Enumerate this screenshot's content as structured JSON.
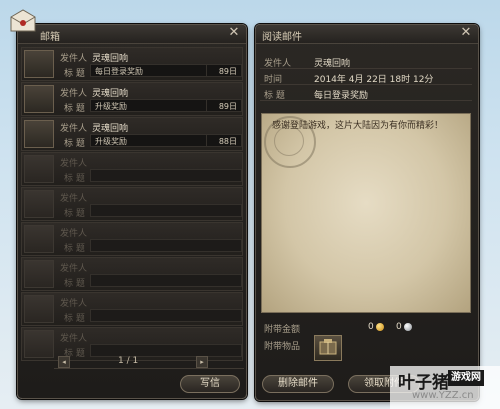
{
  "mailbox": {
    "title": "邮箱",
    "sender_label": "发件人",
    "subject_label": "标 题",
    "rows": [
      {
        "sender": "灵魂回响",
        "subject": "每日登录奖励",
        "days": "89日",
        "icon": "package-icon"
      },
      {
        "sender": "灵魂回响",
        "subject": "升级奖励",
        "days": "89日",
        "icon": "package-icon"
      },
      {
        "sender": "灵魂回响",
        "subject": "升级奖励",
        "days": "88日",
        "icon": "package-icon"
      },
      {
        "sender": "",
        "subject": "",
        "days": "",
        "icon": "envelope-icon"
      },
      {
        "sender": "",
        "subject": "",
        "days": "",
        "icon": "envelope-icon"
      },
      {
        "sender": "",
        "subject": "",
        "days": "",
        "icon": "envelope-icon"
      },
      {
        "sender": "",
        "subject": "",
        "days": "",
        "icon": "envelope-icon"
      },
      {
        "sender": "",
        "subject": "",
        "days": "",
        "icon": "envelope-icon"
      },
      {
        "sender": "",
        "subject": "",
        "days": "",
        "icon": "envelope-icon"
      }
    ],
    "pager": "1 / 1",
    "prev_icon": "◂",
    "next_icon": "▸",
    "write_label": "写信",
    "close_icon": "✕"
  },
  "reader": {
    "title": "阅读邮件",
    "close_icon": "✕",
    "sender_label": "发件人",
    "sender": "灵魂回响",
    "time_label": "时间",
    "time": "2014年 4月 22日 18时 12分",
    "subject_label": "标 题",
    "subject": "每日登录奖励",
    "body": "感谢登陆游戏，这片大陆因为有你而精彩！",
    "money_label": "附带金额",
    "gold": "0",
    "silver": "0",
    "items_label": "附带物品",
    "delete_label": "删除邮件",
    "collect_label": "领取附件"
  },
  "watermark": {
    "title": "叶子猪",
    "badge": "游戏网",
    "url": "www.YZZ.cn"
  },
  "colors": {
    "panel_bg": "#25221f",
    "border": "#5a534a",
    "paper": "#ddd2b8",
    "text_light": "#e1d8c5"
  }
}
